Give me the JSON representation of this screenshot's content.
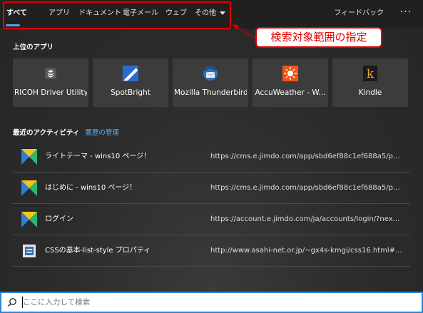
{
  "tabs": [
    {
      "label": "すべて"
    },
    {
      "label": "アプリ"
    },
    {
      "label": "ドキュメント"
    },
    {
      "label": "電子メール"
    },
    {
      "label": "ウェブ"
    },
    {
      "label": "その他"
    }
  ],
  "header": {
    "feedback_label": "フィードバック",
    "more_label": "···"
  },
  "annotation": {
    "callout_text": "検索対象範囲の指定",
    "highlight_color": "#e00000"
  },
  "top_apps": {
    "title": "上位のアプリ",
    "items": [
      {
        "label": "RICOH Driver Utility",
        "icon": "ricoh-driver-icon"
      },
      {
        "label": "SpotBright",
        "icon": "spotbright-icon"
      },
      {
        "label": "Mozilla Thunderbird",
        "icon": "thunderbird-icon"
      },
      {
        "label": "AccuWeather - W...",
        "icon": "accuweather-icon"
      },
      {
        "label": "Kindle",
        "icon": "kindle-icon"
      }
    ]
  },
  "recent": {
    "title": "最近のアクティビティ",
    "history_link": "履歴の管理",
    "items": [
      {
        "title": "ライトテーマ - wins10 ページ！",
        "url": "https://cms.e.jimdo.com/app/sbd6ef88c1ef688a5/p...",
        "icon": "jimdo-icon"
      },
      {
        "title": "はじめに - wins10 ページ！",
        "url": "https://cms.e.jimdo.com/app/sbd6ef88c1ef688a5/p...",
        "icon": "jimdo-icon"
      },
      {
        "title": "ログイン",
        "url": "https://account.e.jimdo.com/ja/accounts/login/?nex...",
        "icon": "jimdo-icon"
      },
      {
        "title": "CSSの基本-list-style プロパティ",
        "url": "http://www.asahi-net.or.jp/~gx4s-kmgi/css16.html#...",
        "icon": "film-page-icon"
      }
    ]
  },
  "search": {
    "placeholder": "ここに入力して検索",
    "value": ""
  },
  "colors": {
    "accent": "#4aa3f0",
    "search_border": "#2c86d8",
    "annotation_red": "#e00000"
  }
}
